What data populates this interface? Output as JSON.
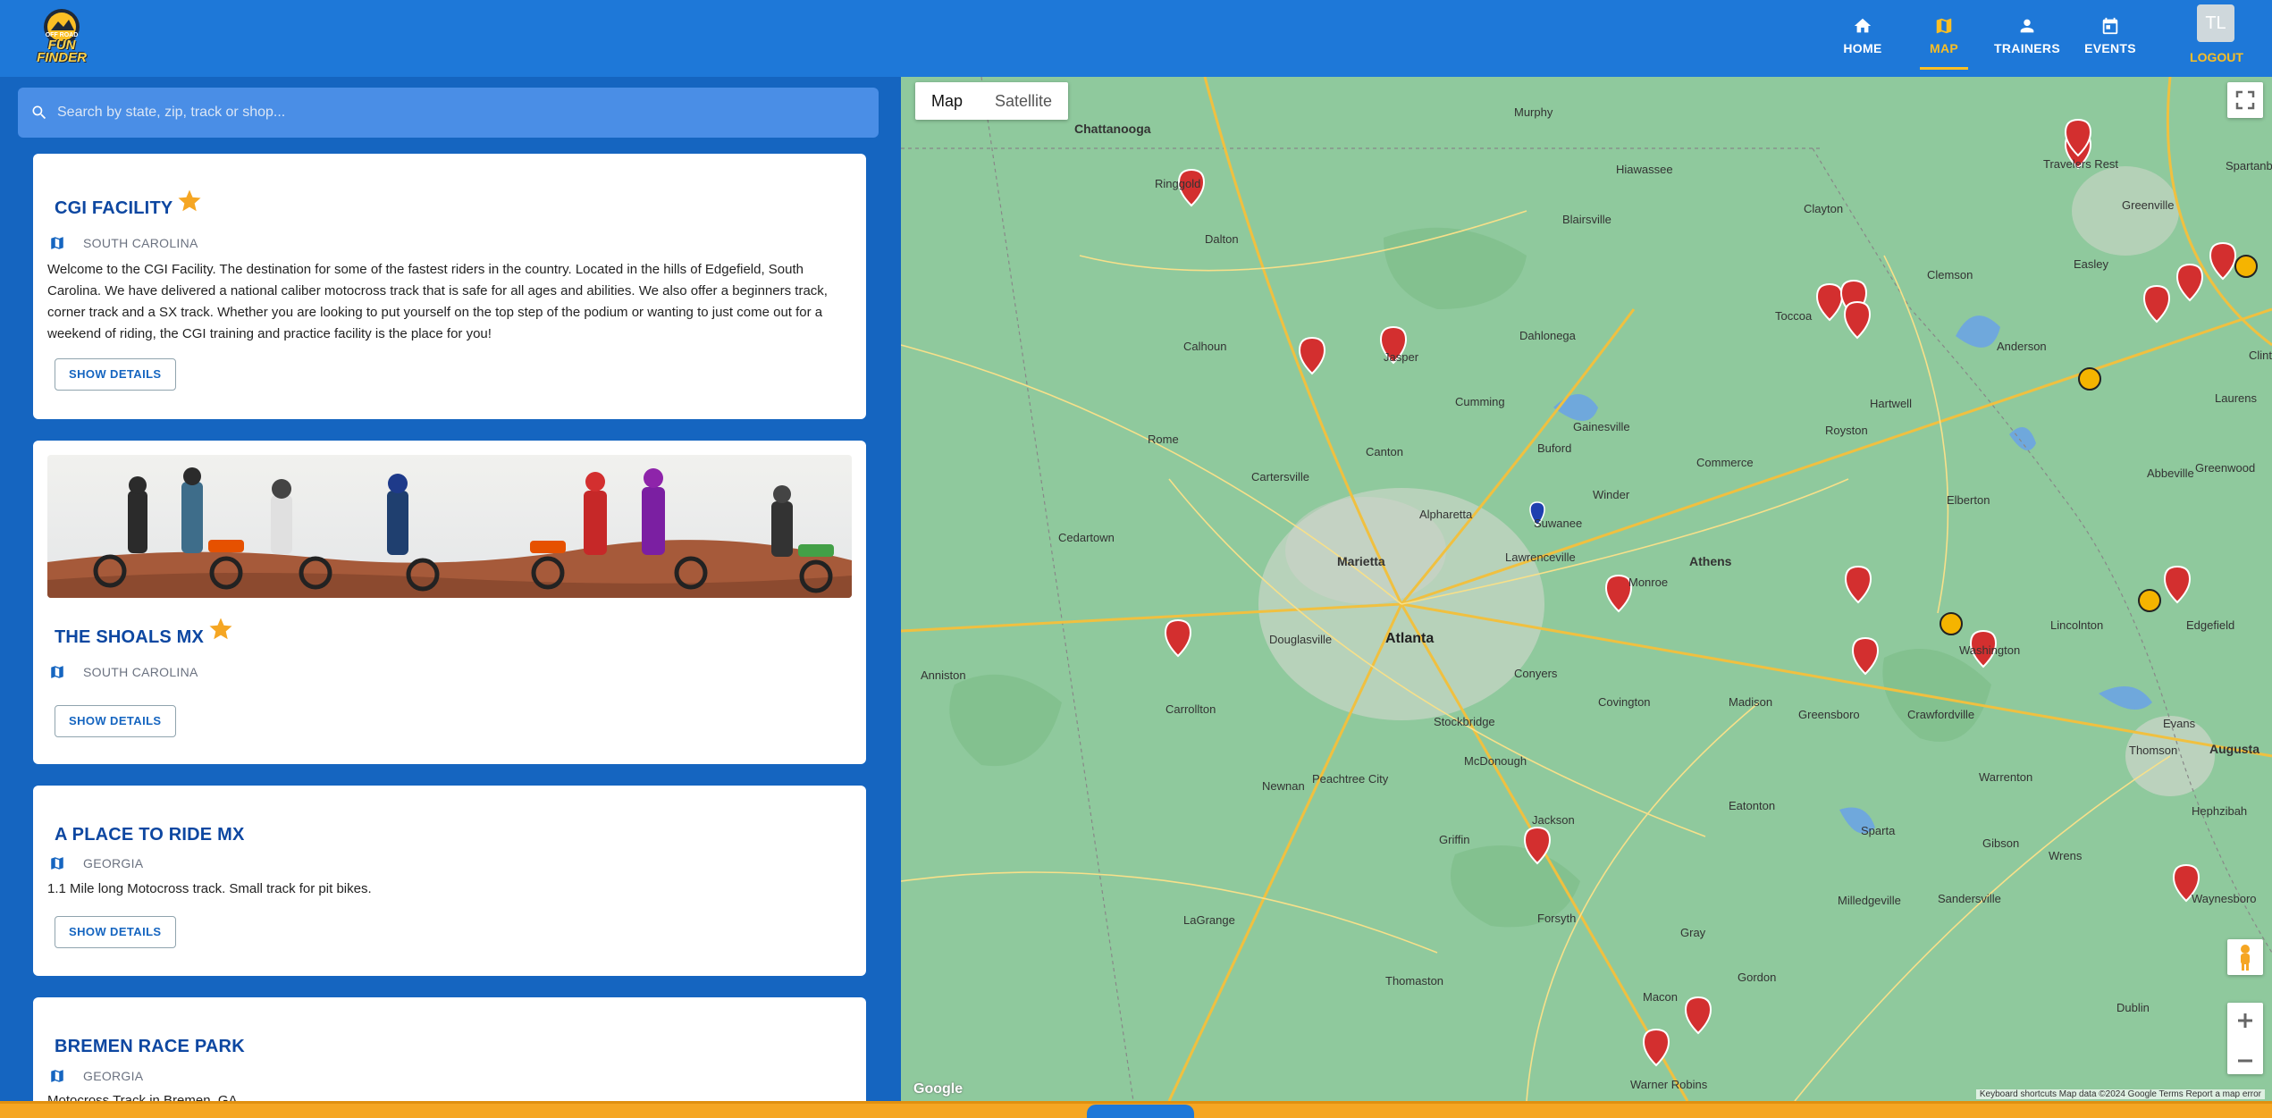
{
  "app": {
    "logo_top": "OFF ROAD",
    "logo_text": "FUN FINDER"
  },
  "nav": {
    "items": [
      {
        "label": "HOME",
        "icon": "home-icon"
      },
      {
        "label": "MAP",
        "icon": "map-icon",
        "active": true
      },
      {
        "label": "TRAINERS",
        "icon": "person-icon"
      },
      {
        "label": "EVENTS",
        "icon": "calendar-icon"
      }
    ],
    "avatar_initials": "TL",
    "logout_label": "LOGOUT"
  },
  "search": {
    "placeholder": "Search by state, zip, track or shop..."
  },
  "listings": [
    {
      "name": "CGI FACILITY",
      "featured": true,
      "state": "SOUTH CAROLINA",
      "description": "Welcome to the CGI Facility. The destination for some of the fastest riders in the country. Located in the hills of Edgefield, South Carolina. We have delivered a national caliber motocross track that is safe for all ages and abilities. We also offer a beginners track, corner track and a SX track. Whether you are looking to put yourself on the top step of the podium or wanting to just come out for a weekend of riding, the CGI training and practice facility is the place for you!",
      "button": "SHOW DETAILS"
    },
    {
      "name": "THE SHOALS MX",
      "featured": true,
      "state": "SOUTH CAROLINA",
      "has_photo": true,
      "button": "SHOW DETAILS"
    },
    {
      "name": "A PLACE TO RIDE MX",
      "featured": false,
      "state": "GEORGIA",
      "description": "1.1 Mile long Motocross track. Small track for pit bikes.",
      "button": "SHOW DETAILS"
    },
    {
      "name": "BREMEN RACE PARK",
      "featured": false,
      "state": "GEORGIA",
      "description": "Motocross Track in Bremen, GA"
    }
  ],
  "map": {
    "type_map": "Map",
    "type_satellite": "Satellite",
    "google": "Google",
    "footer": "Keyboard shortcuts   Map data ©2024 Google   Terms   Report a map error",
    "cities": [
      {
        "name": "Chattanooga",
        "cls": "mid"
      },
      {
        "name": "Atlanta",
        "cls": "big"
      },
      {
        "name": "Athens",
        "cls": "mid"
      },
      {
        "name": "Augusta",
        "cls": "mid"
      },
      {
        "name": "Marietta",
        "cls": "mid"
      },
      {
        "name": "Macon",
        "cls": ""
      },
      {
        "name": "Dalton",
        "cls": ""
      },
      {
        "name": "Gainesville",
        "cls": ""
      },
      {
        "name": "Rome",
        "cls": ""
      },
      {
        "name": "Greenville",
        "cls": ""
      },
      {
        "name": "Spartanburg",
        "cls": ""
      },
      {
        "name": "Anderson",
        "cls": ""
      },
      {
        "name": "Clemson",
        "cls": ""
      },
      {
        "name": "Greenwood",
        "cls": ""
      },
      {
        "name": "Newnan",
        "cls": ""
      },
      {
        "name": "Griffin",
        "cls": ""
      },
      {
        "name": "LaGrange",
        "cls": ""
      },
      {
        "name": "Carrollton",
        "cls": ""
      },
      {
        "name": "Warner Robins",
        "cls": ""
      },
      {
        "name": "Milledgeville",
        "cls": ""
      },
      {
        "name": "Washington",
        "cls": ""
      },
      {
        "name": "Edgefield",
        "cls": ""
      },
      {
        "name": "Cartersville",
        "cls": ""
      },
      {
        "name": "Canton",
        "cls": ""
      },
      {
        "name": "Alpharetta",
        "cls": ""
      },
      {
        "name": "Covington",
        "cls": ""
      },
      {
        "name": "Madison",
        "cls": ""
      },
      {
        "name": "Thomson",
        "cls": ""
      },
      {
        "name": "Waynesboro",
        "cls": ""
      },
      {
        "name": "Sandersville",
        "cls": ""
      },
      {
        "name": "Dublin",
        "cls": ""
      },
      {
        "name": "Thomaston",
        "cls": ""
      },
      {
        "name": "Forsyth",
        "cls": ""
      },
      {
        "name": "Jackson",
        "cls": ""
      },
      {
        "name": "Peachtree City",
        "cls": ""
      },
      {
        "name": "Douglasville",
        "cls": ""
      },
      {
        "name": "Toccoa",
        "cls": ""
      },
      {
        "name": "Hartwell",
        "cls": ""
      },
      {
        "name": "Elberton",
        "cls": ""
      },
      {
        "name": "Lincolnton",
        "cls": ""
      },
      {
        "name": "Dahlonega",
        "cls": ""
      },
      {
        "name": "Jasper",
        "cls": ""
      },
      {
        "name": "Calhoun",
        "cls": ""
      },
      {
        "name": "Ringgold",
        "cls": ""
      },
      {
        "name": "Cedartown",
        "cls": ""
      },
      {
        "name": "Anniston",
        "cls": ""
      },
      {
        "name": "Lawrenceville",
        "cls": ""
      },
      {
        "name": "Suwanee",
        "cls": ""
      },
      {
        "name": "Conyers",
        "cls": ""
      },
      {
        "name": "McDonough",
        "cls": ""
      },
      {
        "name": "Stockbridge",
        "cls": ""
      },
      {
        "name": "Eatonton",
        "cls": ""
      },
      {
        "name": "Greensboro",
        "cls": ""
      },
      {
        "name": "Crawfordville",
        "cls": ""
      },
      {
        "name": "Clinton",
        "cls": ""
      },
      {
        "name": "Laurens",
        "cls": ""
      },
      {
        "name": "Abbeville",
        "cls": ""
      },
      {
        "name": "Easley",
        "cls": ""
      },
      {
        "name": "Travelers Rest",
        "cls": ""
      },
      {
        "name": "Blairsville",
        "cls": ""
      },
      {
        "name": "Hiawassee",
        "cls": ""
      },
      {
        "name": "Clayton",
        "cls": ""
      },
      {
        "name": "Murphy",
        "cls": ""
      },
      {
        "name": "Cumming",
        "cls": ""
      },
      {
        "name": "Buford",
        "cls": ""
      },
      {
        "name": "Winder",
        "cls": ""
      },
      {
        "name": "Monroe",
        "cls": ""
      },
      {
        "name": "Commerce",
        "cls": ""
      },
      {
        "name": "Royston",
        "cls": ""
      },
      {
        "name": "Gray",
        "cls": ""
      },
      {
        "name": "Gordon",
        "cls": ""
      },
      {
        "name": "Sparta",
        "cls": ""
      },
      {
        "name": "Warrenton",
        "cls": ""
      },
      {
        "name": "Evans",
        "cls": ""
      },
      {
        "name": "Hephzibah",
        "cls": ""
      },
      {
        "name": "Wrens",
        "cls": ""
      },
      {
        "name": "Gibson",
        "cls": ""
      }
    ]
  },
  "colors": {
    "header": "#1e78d8",
    "panel": "#1565c0",
    "accent": "#fbbf24",
    "title": "#0d47a1",
    "marker": "#d32f2f"
  }
}
